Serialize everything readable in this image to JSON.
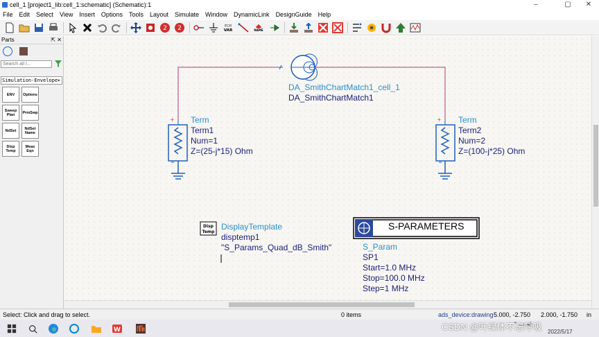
{
  "window": {
    "title": "cell_1 [project1_lib:cell_1:schematic] (Schematic):1",
    "minimize": "–",
    "maximize": "▢",
    "close": "✕"
  },
  "menu": [
    "File",
    "Edit",
    "Select",
    "View",
    "Insert",
    "Options",
    "Tools",
    "Layout",
    "Simulate",
    "Window",
    "DynamicLink",
    "DesignGuide",
    "Help"
  ],
  "toolbar": {
    "icons": [
      "new-file-icon",
      "open-folder-icon",
      "save-icon",
      "print-icon",
      "select-arrow-icon",
      "delete-icon",
      "undo-icon",
      "redo-icon",
      "move-icon",
      "zoom-icon",
      "zoom-in-icon",
      "zoom-out-icon",
      "ground-icon",
      "wire-icon",
      "var-icon",
      "wire-label-icon",
      "name-icon",
      "port-icon",
      "push-into-icon",
      "pop-out-icon",
      "deactivate-icon",
      "activate-icon",
      "tune-icon",
      "optimize-icon",
      "simulate-icon",
      "data-display-icon"
    ],
    "var_label": "VAR",
    "name_label": "NAME",
    "ground_label": "0110"
  },
  "parts": {
    "header": "Parts",
    "search_placeholder": "Search all l...",
    "palette": "Simulation-Envelope",
    "items": [
      {
        "label": "ENV"
      },
      {
        "label": "Options"
      },
      {
        "label": "Sweep Plan"
      },
      {
        "label": "PrmSwp"
      },
      {
        "label": "NdSet"
      },
      {
        "label": "NdSet Name"
      },
      {
        "label": "Disp Temp"
      },
      {
        "label": "Meas Eqn"
      }
    ]
  },
  "schematic": {
    "smith": {
      "instance": "DA_SmithChartMatch1_cell_1",
      "name": "DA_SmithChartMatch1"
    },
    "term1": {
      "type": "Term",
      "name": "Term1",
      "num": "Num=1",
      "z": "Z=(25-j*15) Ohm"
    },
    "term2": {
      "type": "Term",
      "name": "Term2",
      "num": "Num=2",
      "z": "Z=(100-j*25) Ohm"
    },
    "display_template": {
      "icon_label": "Disp Temp",
      "type": "DisplayTemplate",
      "name": "disptemp1",
      "value": "\"S_Params_Quad_dB_Smith\""
    },
    "sparams": {
      "banner": "S-PARAMETERS",
      "type": "S_Param",
      "name": "SP1",
      "start": "Start=1.0 MHz",
      "stop": "Stop=100.0 MHz",
      "step": "Step=1 MHz"
    }
  },
  "status": {
    "message": "Select: Click and drag to select.",
    "items": "0 items",
    "mode": "ads_device:drawing",
    "coord1": "5.000, -2.750",
    "coord2": "2.000, -1.750",
    "unit": "in"
  },
  "taskbar": {
    "apps": [
      "start-icon",
      "search-icon",
      "task-view-icon",
      "edge-icon",
      "mail-icon",
      "explorer-icon",
      "wps-icon",
      "ads-icon"
    ],
    "date": "2022/5/17",
    "watermark": "CSDN @叶绿体不忘呼吸"
  }
}
